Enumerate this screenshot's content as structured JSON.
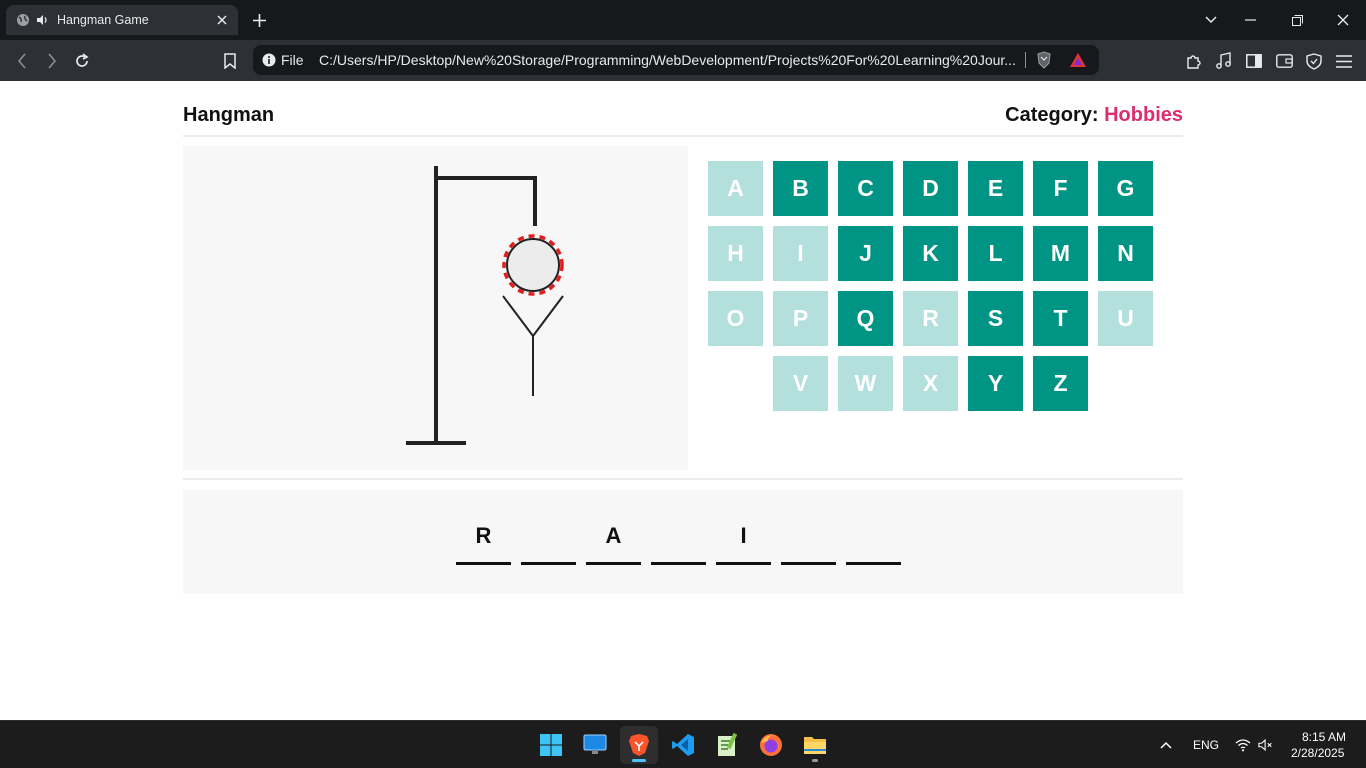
{
  "browser": {
    "tab_title": "Hangman Game",
    "url_scheme_label": "File",
    "url": "C:/Users/HP/Desktop/New%20Storage/Programming/WebDevelopment/Projects%20For%20Learning%20Jour..."
  },
  "game": {
    "title": "Hangman",
    "category_label": "Category:",
    "category_value": "Hobbies",
    "keyboard": [
      {
        "letter": "A",
        "state": "used"
      },
      {
        "letter": "B",
        "state": "active"
      },
      {
        "letter": "C",
        "state": "active"
      },
      {
        "letter": "D",
        "state": "active"
      },
      {
        "letter": "E",
        "state": "active"
      },
      {
        "letter": "F",
        "state": "active"
      },
      {
        "letter": "G",
        "state": "active"
      },
      {
        "letter": "H",
        "state": "used"
      },
      {
        "letter": "I",
        "state": "used"
      },
      {
        "letter": "J",
        "state": "active"
      },
      {
        "letter": "K",
        "state": "active"
      },
      {
        "letter": "L",
        "state": "active"
      },
      {
        "letter": "M",
        "state": "active"
      },
      {
        "letter": "N",
        "state": "active"
      },
      {
        "letter": "O",
        "state": "used"
      },
      {
        "letter": "P",
        "state": "used"
      },
      {
        "letter": "Q",
        "state": "active"
      },
      {
        "letter": "R",
        "state": "used"
      },
      {
        "letter": "S",
        "state": "active"
      },
      {
        "letter": "T",
        "state": "active"
      },
      {
        "letter": "U",
        "state": "used"
      },
      {
        "letter": "V",
        "state": "used"
      },
      {
        "letter": "W",
        "state": "used"
      },
      {
        "letter": "X",
        "state": "used"
      },
      {
        "letter": "Y",
        "state": "active"
      },
      {
        "letter": "Z",
        "state": "active"
      }
    ],
    "word_slots": [
      "R",
      "",
      "A",
      "",
      "I",
      "",
      ""
    ],
    "hangman_parts_shown": [
      "gallows",
      "rope",
      "head",
      "body",
      "left-arm",
      "right-arm"
    ]
  },
  "colors": {
    "key_active": "#009485",
    "key_used": "#b3dfdd",
    "category_accent": "#dc2d6e",
    "rope": "#e11d1d"
  },
  "taskbar": {
    "apps": [
      "start-icon",
      "desktop-icon",
      "brave-icon",
      "vscode-icon",
      "notepad-icon",
      "firefox-icon",
      "file-explorer-icon"
    ],
    "language": "ENG",
    "time": "8:15 AM",
    "date": "2/28/2025"
  }
}
